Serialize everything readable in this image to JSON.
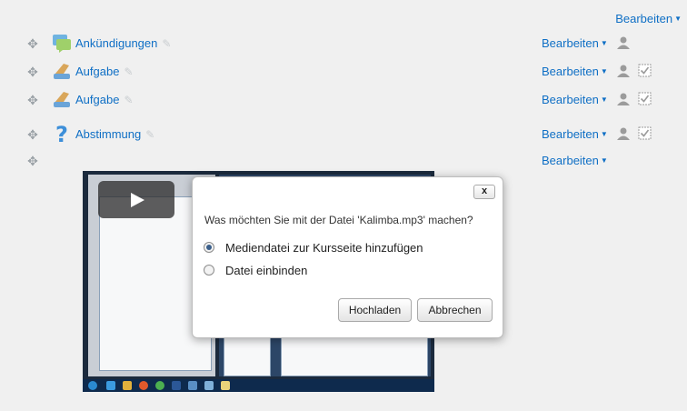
{
  "header": {
    "edit_label": "Bearbeiten"
  },
  "activities": [
    {
      "name": "Ankündigungen",
      "icon": "forum-icon",
      "edit_label": "Bearbeiten",
      "has_completion": false
    },
    {
      "name": "Aufgabe",
      "icon": "assignment-icon",
      "edit_label": "Bearbeiten",
      "has_completion": true
    },
    {
      "name": "Aufgabe",
      "icon": "assignment-icon",
      "edit_label": "Bearbeiten",
      "has_completion": true
    },
    {
      "name": "Abstimmung",
      "icon": "choice-icon",
      "edit_label": "Bearbeiten",
      "has_completion": true
    }
  ],
  "empty_row": {
    "edit_label": "Bearbeiten"
  },
  "dialog": {
    "question": "Was möchten Sie mit der Datei 'Kalimba.mp3' machen?",
    "options": [
      {
        "label": "Mediendatei zur Kursseite hinzufügen",
        "checked": true
      },
      {
        "label": "Datei einbinden",
        "checked": false
      }
    ],
    "upload_button": "Hochladen",
    "cancel_button": "Abbrechen",
    "close_label": "x"
  },
  "colors": {
    "link": "#0f6fc5",
    "background": "#f0f0f0"
  }
}
